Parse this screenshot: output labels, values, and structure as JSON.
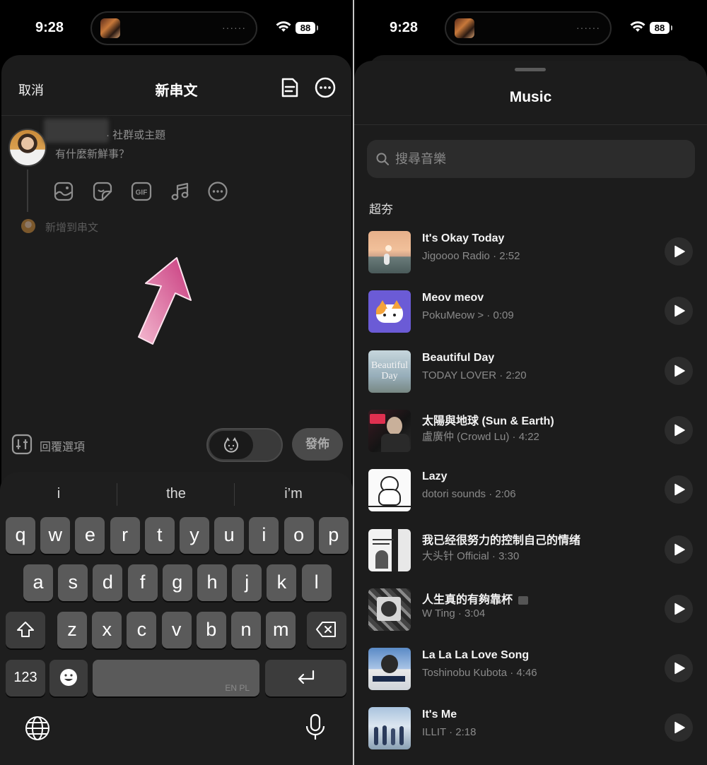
{
  "status": {
    "time": "9:28",
    "battery": "88"
  },
  "compose": {
    "cancel_label": "取消",
    "title": "新串文",
    "community_label": "· 社群或主題",
    "prompt_placeholder": "有什麼新鮮事？",
    "tools": [
      "image-icon",
      "sticker-icon",
      "gif-icon",
      "music-icon",
      "more-icon"
    ],
    "gif_label": "GIF",
    "add_thread_label": "新增到串文",
    "reply_options_label": "回覆選項",
    "post_label": "發佈",
    "highlight_color": "#d24a8a"
  },
  "keyboard": {
    "suggestions": [
      "i",
      "the",
      "i’m"
    ],
    "row1": [
      "q",
      "w",
      "e",
      "r",
      "t",
      "y",
      "u",
      "i",
      "o",
      "p"
    ],
    "row2": [
      "a",
      "s",
      "d",
      "f",
      "g",
      "h",
      "j",
      "k",
      "l"
    ],
    "row3": [
      "z",
      "x",
      "c",
      "v",
      "b",
      "n",
      "m"
    ],
    "numbers_label": "123",
    "space_language": "EN PL"
  },
  "music": {
    "title": "Music",
    "search_placeholder": "搜尋音樂",
    "section_label": "超夯",
    "tracks": [
      {
        "title": "It's Okay Today",
        "artist": "Jigoooo Radio",
        "duration": "2:52",
        "cover": "sunset"
      },
      {
        "title": "Meov meov",
        "artist": "PokuMeow >",
        "duration": "0:09",
        "cover": "cat"
      },
      {
        "title": "Beautiful Day",
        "artist": "TODAY LOVER",
        "duration": "2:20",
        "cover": "beautiful-day"
      },
      {
        "title": "太陽與地球 (Sun & Earth)",
        "artist": "盧廣仲 (Crowd Lu)",
        "duration": "4:22",
        "cover": "portrait-red"
      },
      {
        "title": "Lazy",
        "artist": "dotori sounds",
        "duration": "2:06",
        "cover": "bear"
      },
      {
        "title": "我已经很努力的控制自己的情绪",
        "artist": "大头针 Official",
        "duration": "3:30",
        "cover": "bw"
      },
      {
        "title": "人生真的有夠靠杯",
        "artist": "W Ting",
        "duration": "3:04",
        "cover": "collage",
        "explicit": true
      },
      {
        "title": "La La La Love Song",
        "artist": "Toshinobu Kubota",
        "duration": "4:46",
        "cover": "kubota"
      },
      {
        "title": "It's Me",
        "artist": "ILLIT",
        "duration": "2:18",
        "cover": "illit"
      }
    ]
  }
}
